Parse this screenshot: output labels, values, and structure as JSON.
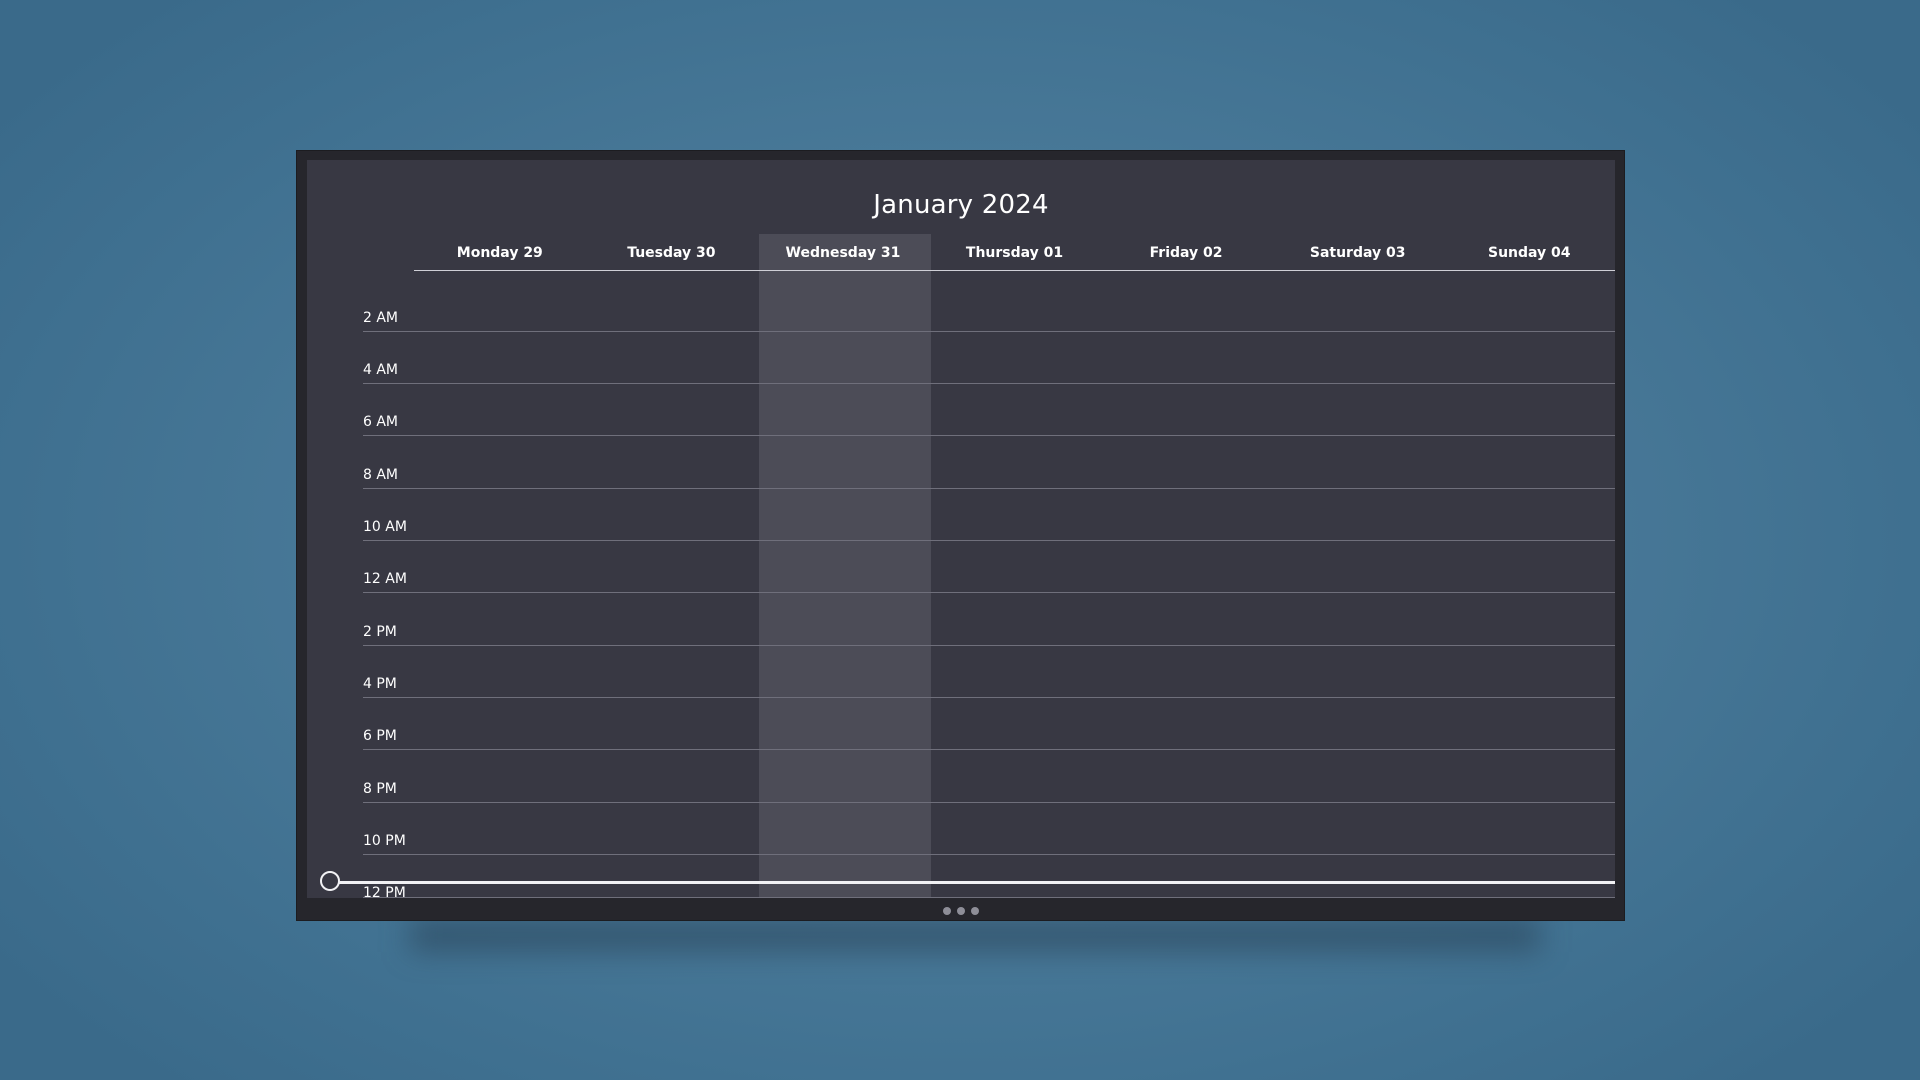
{
  "calendar": {
    "title": "January 2024",
    "days": [
      {
        "label": "Monday 29"
      },
      {
        "label": "Tuesday 30"
      },
      {
        "label": "Wednesday 31",
        "today": true
      },
      {
        "label": "Thursday 01"
      },
      {
        "label": "Friday 02"
      },
      {
        "label": "Saturday 03"
      },
      {
        "label": "Sunday 04"
      }
    ],
    "hours": [
      "2 AM",
      "4 AM",
      "6 AM",
      "8 AM",
      "10 AM",
      "12 AM",
      "2 PM",
      "4 PM",
      "6 PM",
      "8 PM",
      "10 PM",
      "12 PM"
    ]
  },
  "pager": {
    "dot_count": 3
  },
  "colors": {
    "background": "#3f7090",
    "screen": "#383843",
    "today_column": "#4c4c57",
    "text": "#ffffff",
    "now_indicator": "#f1f1f4"
  }
}
